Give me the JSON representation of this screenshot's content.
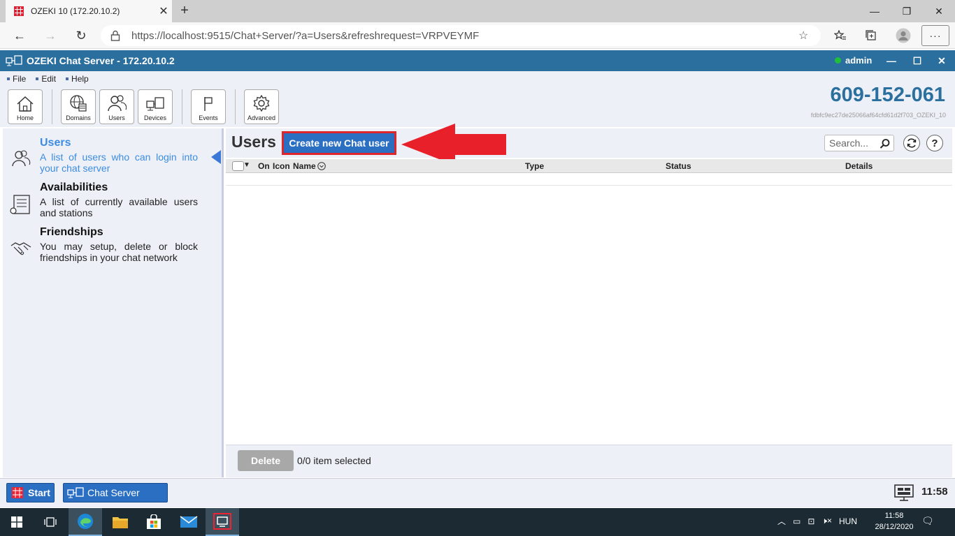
{
  "browser": {
    "tab_title": "OZEKI 10 (172.20.10.2)",
    "url": "https://localhost:9515/Chat+Server/?a=Users&refreshrequest=VRPVEYMF"
  },
  "app": {
    "title": "OZEKI Chat Server - 172.20.10.2",
    "user": "admin",
    "menu": [
      "File",
      "Edit",
      "Help"
    ],
    "toolbar": {
      "home": "Home",
      "domains": "Domains",
      "users": "Users",
      "devices": "Devices",
      "events": "Events",
      "advanced": "Advanced"
    },
    "phone": "609-152-061",
    "serial": "fdbfc9ec27de25066af64cfd61d2f703_OZEKI_10"
  },
  "sidebar": {
    "items": [
      {
        "title": "Users",
        "desc": "A list of users who can login into your chat server",
        "active": true
      },
      {
        "title": "Availabilities",
        "desc": "A list of currently available users and stations",
        "active": false
      },
      {
        "title": "Friendships",
        "desc": "You may setup, delete or block friendships in your chat network",
        "active": false
      }
    ]
  },
  "main": {
    "title": "Users",
    "create_button": "Create new Chat user",
    "search_placeholder": "Search...",
    "columns": {
      "on": "On",
      "icon": "Icon",
      "name": "Name",
      "type": "Type",
      "status": "Status",
      "details": "Details"
    },
    "delete_button": "Delete",
    "selection_info": "0/0 item selected"
  },
  "app_taskbar": {
    "start": "Start",
    "chat_server": "Chat Server",
    "clock": "11:58"
  },
  "windows_taskbar": {
    "lang": "HUN",
    "time": "11:58",
    "date": "28/12/2020"
  },
  "colors": {
    "accent": "#2b6f9f",
    "button_blue": "#2b6fc2",
    "highlight_red": "#e0242b",
    "active_link": "#3b8ce0"
  }
}
